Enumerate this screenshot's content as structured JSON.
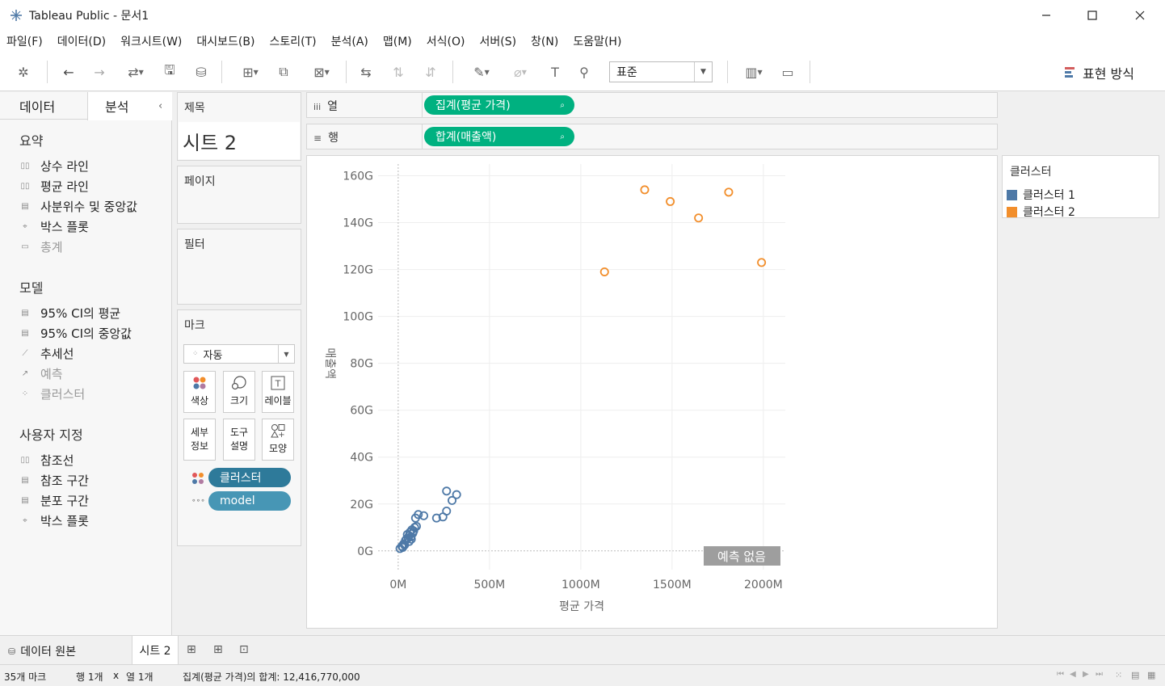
{
  "window": {
    "title": "Tableau Public - 문서1",
    "min_icon": "minimize-icon",
    "max_icon": "maximize-icon",
    "close_icon": "close-icon"
  },
  "menu": [
    "파일(F)",
    "데이터(D)",
    "워크시트(W)",
    "대시보드(B)",
    "스토리(T)",
    "분석(A)",
    "맵(M)",
    "서식(O)",
    "서버(S)",
    "창(N)",
    "도움말(H)"
  ],
  "toolbar": {
    "standard_dropdown": "표준",
    "show_me": "표현 방식"
  },
  "left_panel": {
    "tab_data": "데이터",
    "tab_analysis": "분석",
    "collapse_icon": "chevron-left-icon",
    "sections": {
      "summary": "요약",
      "model": "모델",
      "custom": "사용자 지정"
    },
    "summary_items": [
      "상수 라인",
      "평균 라인",
      "사분위수 및 중앙값",
      "박스 플롯",
      "총계"
    ],
    "model_items": [
      "95% CI의 평균",
      "95% CI의 중앙값",
      "추세선",
      "예측",
      "클러스터"
    ],
    "custom_items": [
      "참조선",
      "참조 구간",
      "분포 구간",
      "박스 플롯"
    ]
  },
  "title_card": {
    "label": "제목",
    "value": "시트 2"
  },
  "pages_card": {
    "label": "페이지"
  },
  "filters_card": {
    "label": "필터"
  },
  "marks_card": {
    "label": "마크",
    "type": "자동",
    "buttons": {
      "color": "색상",
      "size": "크기",
      "label": "레이블",
      "detail_1": "세부",
      "detail_2": "정보",
      "tooltip_1": "도구",
      "tooltip_2": "설명",
      "shape": "모양"
    },
    "pills": [
      "클러스터",
      "model"
    ]
  },
  "shelves": {
    "columns_label": "열",
    "rows_label": "행",
    "columns_pill": "집계(평균 가격)",
    "rows_pill": "합계(매출액)"
  },
  "legend": {
    "title": "클러스터",
    "items": [
      {
        "label": "클러스터 1",
        "color": "#4e79a7"
      },
      {
        "label": "클러스터 2",
        "color": "#f28e2b"
      }
    ]
  },
  "forecast_badge": "예측 없음",
  "chart_data": {
    "type": "scatter",
    "xlabel": "평균 가격",
    "ylabel": "매출액",
    "x_ticks": [
      "0M",
      "500M",
      "1000M",
      "1500M",
      "2000M"
    ],
    "y_ticks": [
      "0G",
      "20G",
      "40G",
      "60G",
      "80G",
      "100G",
      "120G",
      "140G",
      "160G"
    ],
    "xlim": [
      -110,
      2120
    ],
    "ylim": [
      -8,
      165
    ],
    "grid": true,
    "series": [
      {
        "name": "클러스터 1",
        "color": "#4e79a7",
        "points": [
          [
            10,
            1
          ],
          [
            20,
            2
          ],
          [
            30,
            3
          ],
          [
            40,
            4.5
          ],
          [
            55,
            5.5
          ],
          [
            45,
            5
          ],
          [
            60,
            4
          ],
          [
            50,
            7
          ],
          [
            70,
            6
          ],
          [
            80,
            7.5
          ],
          [
            65,
            8
          ],
          [
            75,
            9
          ],
          [
            85,
            8.5
          ],
          [
            90,
            10
          ],
          [
            100,
            10.5
          ],
          [
            95,
            14
          ],
          [
            110,
            15.5
          ],
          [
            140,
            15
          ],
          [
            210,
            14
          ],
          [
            245,
            14.5
          ],
          [
            265,
            17
          ],
          [
            295,
            21.5
          ],
          [
            265,
            25.5
          ],
          [
            320,
            24
          ],
          [
            35,
            2.5
          ],
          [
            25,
            1.5
          ],
          [
            60,
            6.5
          ],
          [
            72,
            5
          ]
        ]
      },
      {
        "name": "클러스터 2",
        "color": "#f28e2b",
        "points": [
          [
            1130,
            119
          ],
          [
            1350,
            154
          ],
          [
            1490,
            149
          ],
          [
            1645,
            142
          ],
          [
            1810,
            153
          ],
          [
            1990,
            123
          ]
        ]
      }
    ]
  },
  "bottom_tabs": {
    "datasource": "데이터 원본",
    "sheet": "시트 2"
  },
  "status": {
    "marks": "35개 마크",
    "rows": "행 1개",
    "x": "x",
    "cols": "열 1개",
    "sum": "집계(평균 가격)의 합계: 12,416,770,000"
  }
}
